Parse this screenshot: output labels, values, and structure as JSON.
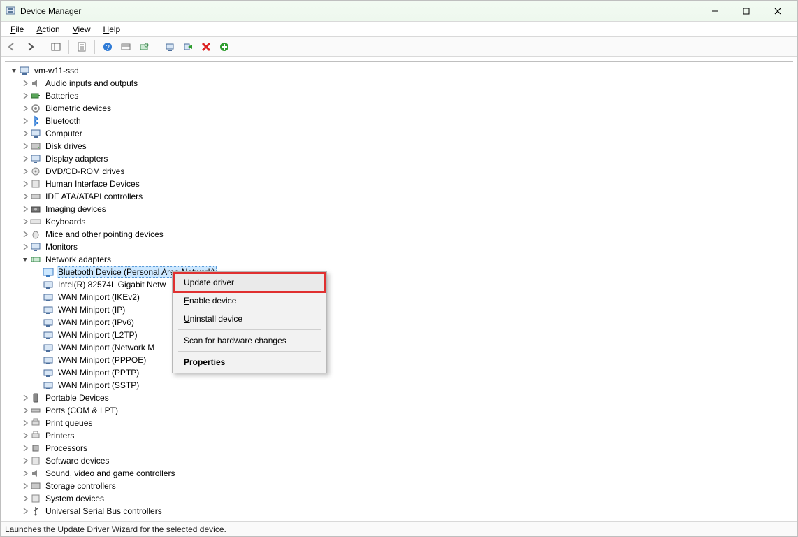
{
  "window": {
    "title": "Device Manager"
  },
  "menu": {
    "file": "File",
    "action": "Action",
    "view": "View",
    "help": "Help"
  },
  "tree": {
    "root": "vm-w11-ssd",
    "categories": [
      "Audio inputs and outputs",
      "Batteries",
      "Biometric devices",
      "Bluetooth",
      "Computer",
      "Disk drives",
      "Display adapters",
      "DVD/CD-ROM drives",
      "Human Interface Devices",
      "IDE ATA/ATAPI controllers",
      "Imaging devices",
      "Keyboards",
      "Mice and other pointing devices",
      "Monitors",
      "Network adapters",
      "Portable Devices",
      "Ports (COM & LPT)",
      "Print queues",
      "Printers",
      "Processors",
      "Software devices",
      "Sound, video and game controllers",
      "Storage controllers",
      "System devices",
      "Universal Serial Bus controllers"
    ],
    "network_children": [
      "Bluetooth Device (Personal Area Network)",
      "Intel(R) 82574L Gigabit Netw",
      "WAN Miniport (IKEv2)",
      "WAN Miniport (IP)",
      "WAN Miniport (IPv6)",
      "WAN Miniport (L2TP)",
      "WAN Miniport (Network M",
      "WAN Miniport (PPPOE)",
      "WAN Miniport (PPTP)",
      "WAN Miniport (SSTP)"
    ]
  },
  "context_menu": {
    "update_driver": "Update driver",
    "enable_device": "Enable device",
    "uninstall_device": "Uninstall device",
    "scan_hardware": "Scan for hardware changes",
    "properties": "Properties"
  },
  "statusbar": "Launches the Update Driver Wizard for the selected device."
}
